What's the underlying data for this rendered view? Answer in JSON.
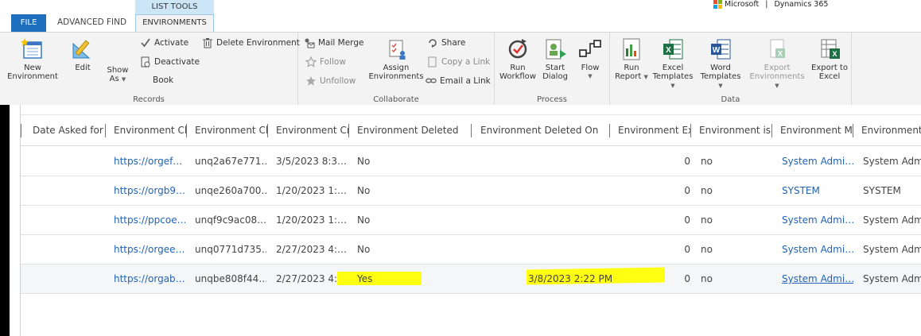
{
  "tabs": {
    "file": "FILE",
    "advanced_find": "ADVANCED FIND",
    "context_group": "LIST TOOLS",
    "environments": "ENVIRONMENTS"
  },
  "brand": {
    "microsoft": "Microsoft",
    "separator": "|",
    "product": "Dynamics 365"
  },
  "ribbon": {
    "records": {
      "label": "Records",
      "new": [
        "New",
        "Environment"
      ],
      "edit": "Edit",
      "show_as": [
        "Show",
        "As"
      ],
      "activate": "Activate",
      "deactivate": "Deactivate",
      "book": "Book",
      "delete": "Delete Environment"
    },
    "collaborate": {
      "label": "Collaborate",
      "mail_merge": "Mail Merge",
      "follow": "Follow",
      "unfollow": "Unfollow",
      "assign": [
        "Assign",
        "Environments"
      ],
      "share": "Share",
      "copy_link": "Copy a Link",
      "email_link": "Email a Link"
    },
    "process": {
      "label": "Process",
      "run_workflow": [
        "Run",
        "Workflow"
      ],
      "start_dialog": [
        "Start",
        "Dialog"
      ],
      "flow": "Flow"
    },
    "data": {
      "label": "Data",
      "run_report": [
        "Run",
        "Report"
      ],
      "excel_templates": [
        "Excel",
        "Templates"
      ],
      "word_templates": [
        "Word",
        "Templates"
      ],
      "export_environments": [
        "Export",
        "Environments"
      ],
      "export_excel": [
        "Export to",
        "Excel"
      ]
    }
  },
  "grid": {
    "columns": [
      "Date Asked for",
      "Environment Cl",
      "Environment Cl",
      "Environment Cr",
      "Environment Deleted",
      "Environment Deleted On",
      "Environment Ex",
      "Environment is",
      "Environment M",
      "Environment"
    ],
    "rows": [
      {
        "url": "https://orgef…",
        "id": "unq2a67e771…",
        "created": "3/5/2023 8:3…",
        "deleted": "No",
        "deleted_on": "",
        "ex": "0",
        "is": "no",
        "maker": "System Admi…",
        "owner": "System Admi"
      },
      {
        "url": "https://orgb9…",
        "id": "unqe260a700…",
        "created": "1/20/2023 1:…",
        "deleted": "No",
        "deleted_on": "",
        "ex": "0",
        "is": "no",
        "maker": "SYSTEM",
        "owner": "SYSTEM"
      },
      {
        "url": "https://ppcoe…",
        "id": "unqf9c9ac08…",
        "created": "1/20/2023 1:…",
        "deleted": "No",
        "deleted_on": "",
        "ex": "0",
        "is": "no",
        "maker": "System Admi…",
        "owner": "System Admi"
      },
      {
        "url": "https://orgee…",
        "id": "unq0771d735…",
        "created": "2/27/2023 4:…",
        "deleted": "No",
        "deleted_on": "",
        "ex": "0",
        "is": "no",
        "maker": "System Admi…",
        "owner": "System Admi"
      },
      {
        "url": "https://orgab…",
        "id": "unqbe808f44…",
        "created": "2/27/2023 4:…",
        "deleted": "Yes",
        "deleted_on": "3/8/2023 2:22 PM",
        "ex": "0",
        "is": "no",
        "maker": "System Admi…",
        "owner": "System Admi"
      }
    ]
  },
  "colors": {
    "accent": "#1f6fbf",
    "link": "#1f62b6",
    "highlight": "#ffff11",
    "ribbon_bg": "#f3f3f3"
  }
}
